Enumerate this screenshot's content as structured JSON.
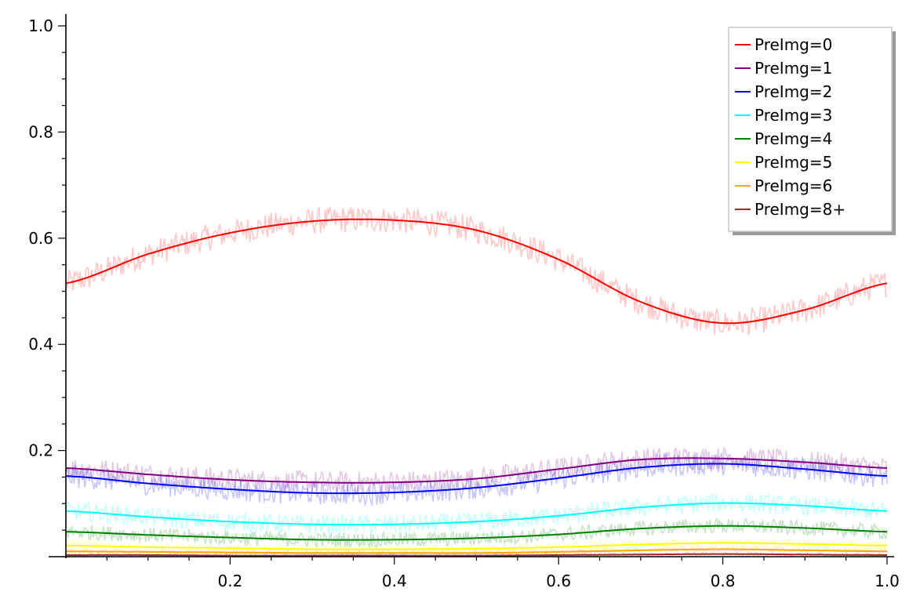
{
  "chart_data": {
    "type": "line",
    "title": "",
    "xlabel": "",
    "ylabel": "",
    "xlim": [
      0.0,
      1.0
    ],
    "ylim": [
      0.0,
      1.0
    ],
    "grid": false,
    "legend_position": "top-right",
    "x_ticks": [
      "0.2",
      "0.4",
      "0.6",
      "0.8",
      "1.0"
    ],
    "y_ticks": [
      "0.2",
      "0.4",
      "0.6",
      "0.8",
      "1.0"
    ],
    "x": [
      0.0,
      0.1,
      0.2,
      0.3,
      0.4,
      0.5,
      0.6,
      0.7,
      0.8,
      0.9,
      1.0
    ],
    "series": [
      {
        "name": "PreImg=0",
        "color": "#ff0000",
        "noise": 0.025,
        "values": [
          0.515,
          0.57,
          0.61,
          0.632,
          0.634,
          0.615,
          0.56,
          0.48,
          0.44,
          0.465,
          0.515
        ]
      },
      {
        "name": "PreImg=1",
        "color": "#800080",
        "noise": 0.022,
        "values": [
          0.167,
          0.155,
          0.145,
          0.14,
          0.14,
          0.147,
          0.165,
          0.183,
          0.185,
          0.178,
          0.167
        ]
      },
      {
        "name": "PreImg=2",
        "color": "#0000ff",
        "noise": 0.022,
        "values": [
          0.152,
          0.138,
          0.127,
          0.12,
          0.121,
          0.13,
          0.148,
          0.168,
          0.175,
          0.165,
          0.152
        ]
      },
      {
        "name": "PreImg=3",
        "color": "#00ffff",
        "noise": 0.018,
        "values": [
          0.086,
          0.075,
          0.066,
          0.061,
          0.061,
          0.066,
          0.077,
          0.093,
          0.101,
          0.096,
          0.086
        ]
      },
      {
        "name": "PreImg=4",
        "color": "#008000",
        "noise": 0.014,
        "values": [
          0.047,
          0.041,
          0.036,
          0.032,
          0.032,
          0.035,
          0.042,
          0.053,
          0.058,
          0.054,
          0.047
        ]
      },
      {
        "name": "PreImg=5",
        "color": "#ffff00",
        "noise": 0.008,
        "values": [
          0.021,
          0.018,
          0.016,
          0.014,
          0.014,
          0.015,
          0.018,
          0.023,
          0.026,
          0.024,
          0.021
        ]
      },
      {
        "name": "PreImg=6",
        "color": "#ffa500",
        "noise": 0.005,
        "values": [
          0.01,
          0.009,
          0.008,
          0.007,
          0.007,
          0.007,
          0.009,
          0.012,
          0.014,
          0.012,
          0.01
        ]
      },
      {
        "name": "PreImg=8+",
        "color": "#a52a2a",
        "noise": 0.003,
        "values": [
          0.003,
          0.003,
          0.002,
          0.002,
          0.002,
          0.002,
          0.003,
          0.004,
          0.005,
          0.004,
          0.003
        ]
      }
    ]
  }
}
